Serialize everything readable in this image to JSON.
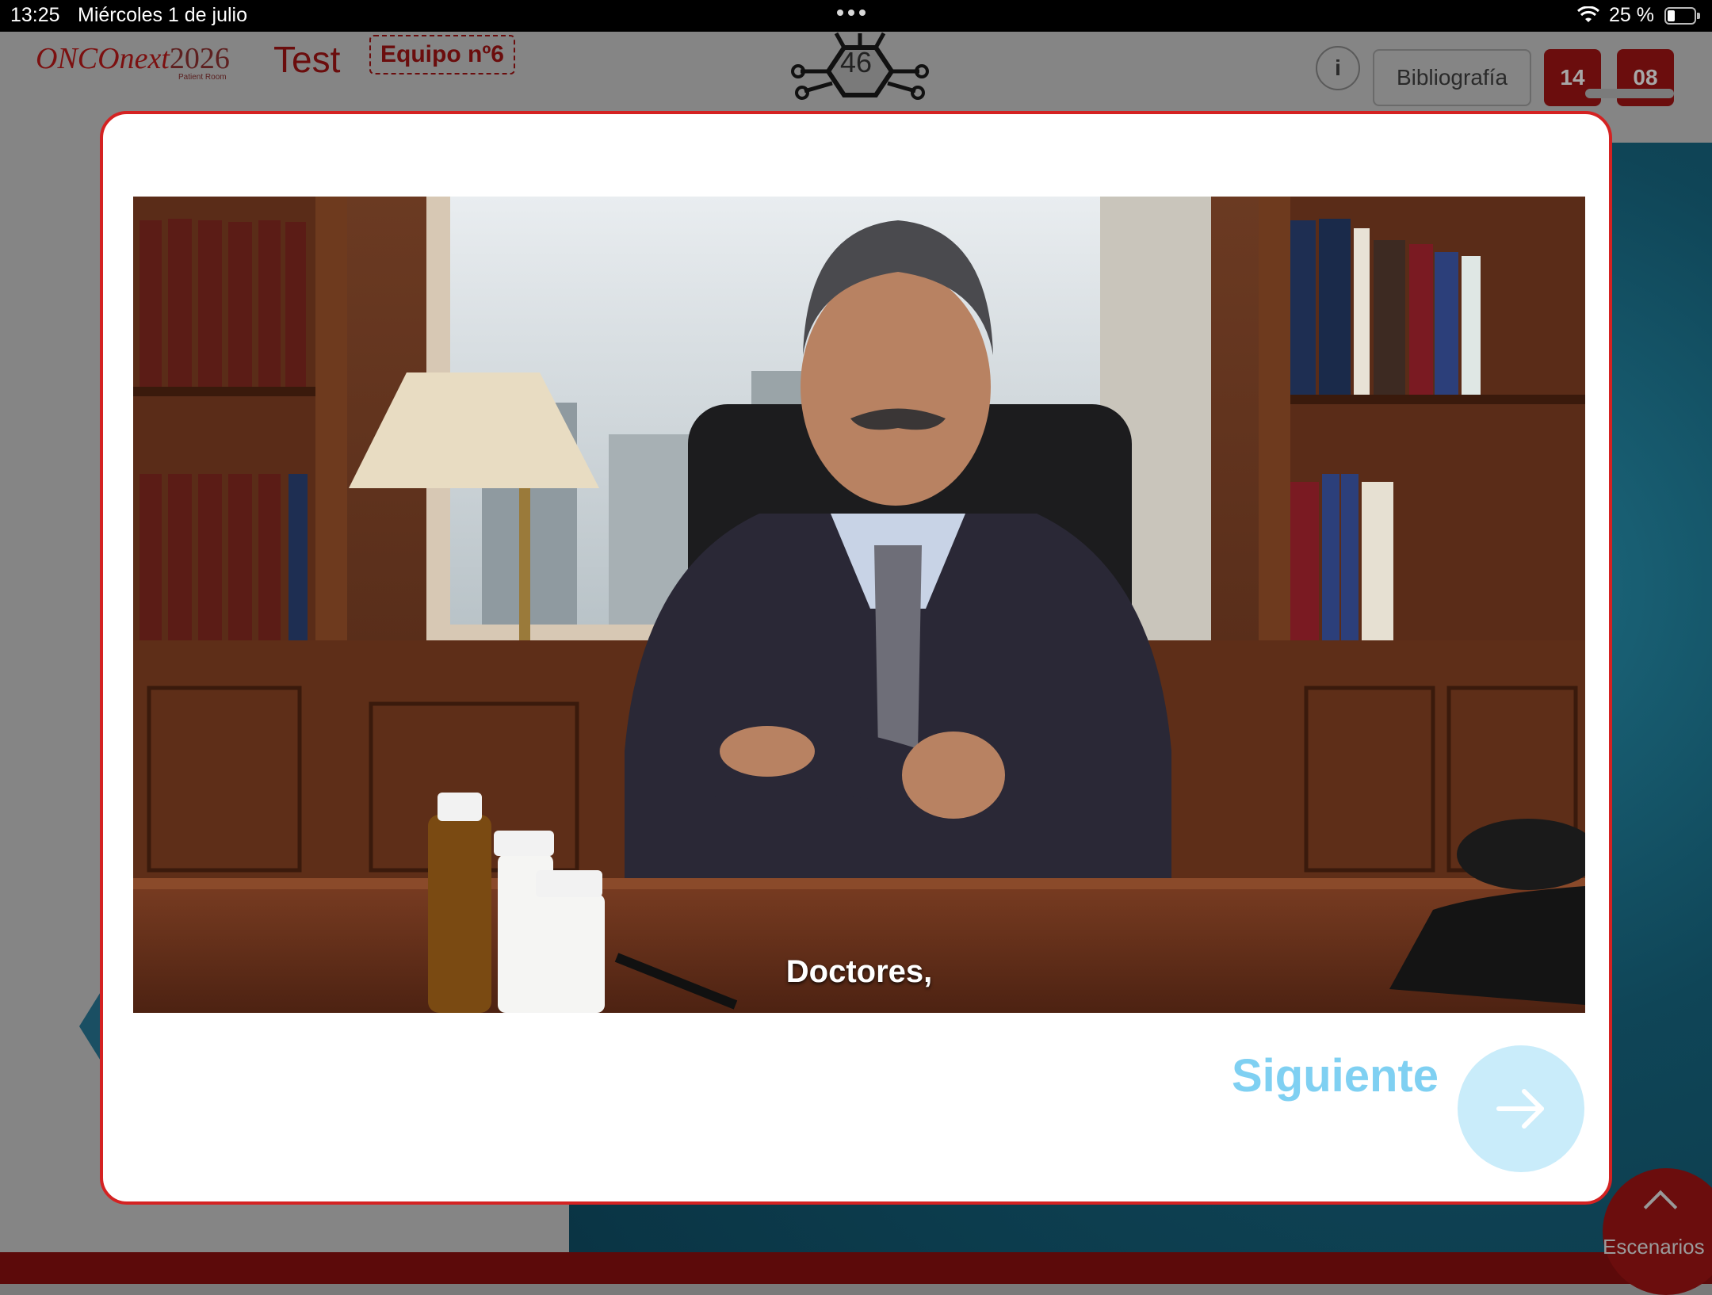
{
  "status_bar": {
    "time": "13:25",
    "date": "Miércoles 1 de julio",
    "battery": "25 %",
    "battery_level": 0.25
  },
  "header": {
    "brand": "ONCOnext",
    "brand_year": "2026",
    "brand_sub": "Patient Room",
    "section": "Test",
    "team": "Equipo nº6",
    "logo_number": "46",
    "info_label": "i",
    "bibliography_label": "Bibliografía",
    "timer_minutes": "14",
    "timer_seconds": "08"
  },
  "footer": {
    "scenarios_label": "Escenarios"
  },
  "modal": {
    "subtitle": "Doctores,",
    "next_label": "Siguiente"
  },
  "colors": {
    "brand_red": "#6b0d0d",
    "modal_border": "#d42222",
    "next_blue": "#7fd0f2",
    "next_circle": "#c9ecfa"
  },
  "icons": [
    "wifi-icon",
    "battery-icon",
    "info-icon",
    "arrow-right-icon",
    "chevron-up-icon",
    "chevron-left-icon"
  ]
}
